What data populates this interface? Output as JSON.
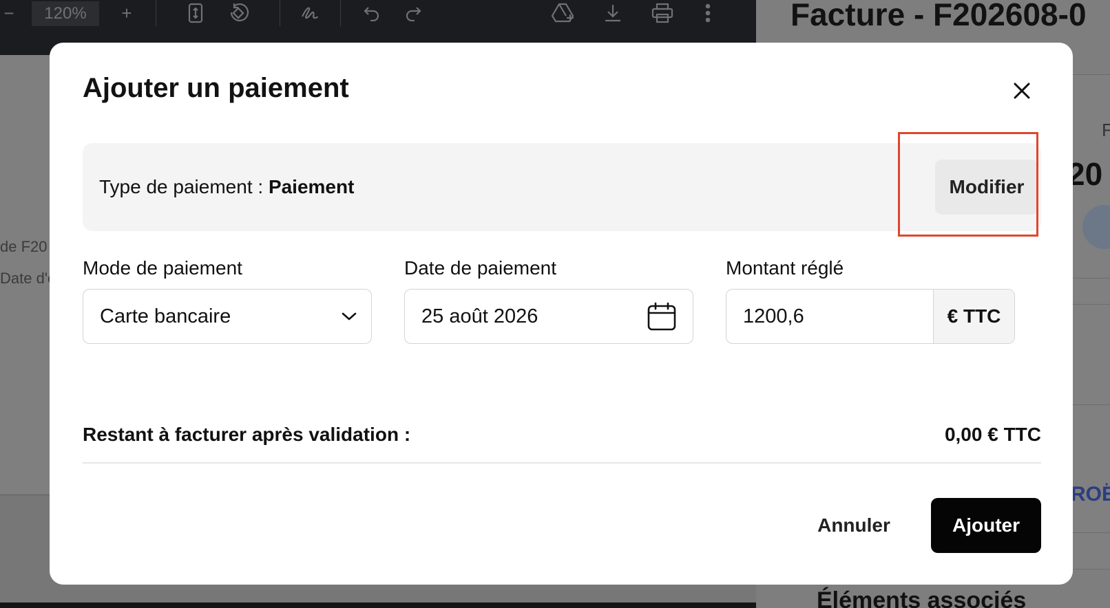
{
  "pdf_toolbar": {
    "minus_label": "−",
    "zoom": "120%",
    "plus_label": "+"
  },
  "pdf_page": {
    "line1": "de F20",
    "line2": "Date d'e"
  },
  "right_panel": {
    "title": "Facture - F202608-0",
    "small_letter": "F",
    "big_text": "20",
    "link_text": "ROË",
    "section_title": "Éléments associés"
  },
  "modal": {
    "title": "Ajouter un paiement",
    "type_prefix": "Type de paiement : ",
    "type_value": "Paiement",
    "modify_label": "Modifier",
    "mode_label": "Mode de paiement",
    "mode_value": "Carte bancaire",
    "date_label": "Date de paiement",
    "date_value": "25 août 2026",
    "amount_label": "Montant réglé",
    "amount_value": "1200,6",
    "amount_suffix": "€ TTC",
    "remaining_label": "Restant à facturer après validation :",
    "remaining_value": "0,00 € TTC",
    "cancel_label": "Annuler",
    "add_label": "Ajouter"
  },
  "colors": {
    "highlight": "#e0452d",
    "primary_button": "#050505",
    "overlay": "#7d7d7d"
  },
  "icons": [
    "close-icon",
    "chevron-down-icon",
    "calendar-icon",
    "drive-add-icon",
    "download-icon",
    "print-icon",
    "more-vert-icon",
    "undo-icon",
    "redo-icon",
    "rotate-icon",
    "fit-page-icon",
    "draw-icon"
  ]
}
